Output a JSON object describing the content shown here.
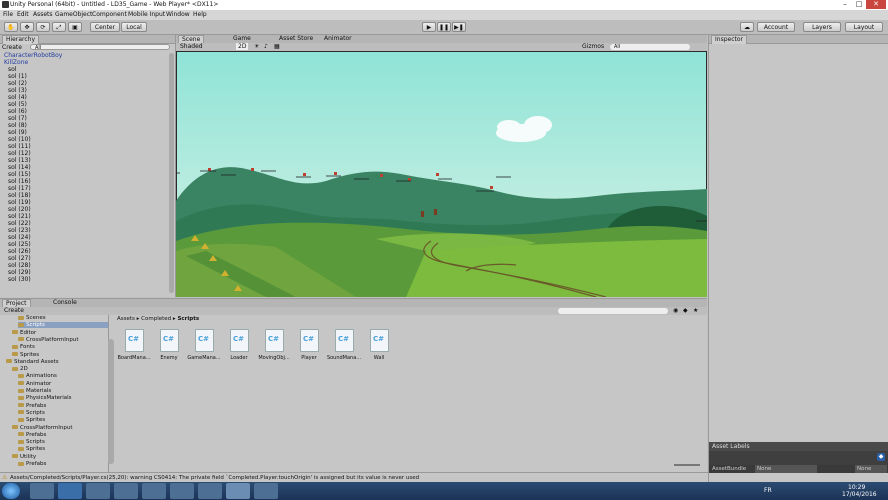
{
  "window": {
    "title": "Unity Personal (64bit) - Untitled - LD35_Game - Web Player* <DX11>"
  },
  "menu": [
    "File",
    "Edit",
    "Assets",
    "GameObject",
    "Component",
    "Mobile Input",
    "Window",
    "Help"
  ],
  "toolbar": {
    "pivot": "Center",
    "space": "Local",
    "account": "Account",
    "layers": "Layers",
    "layout": "Layout"
  },
  "hierarchy": {
    "tab": "Hierarchy",
    "create": "Create",
    "search": "All",
    "items": [
      "CharacterRobotBoy",
      "KillZone",
      "sol",
      "sol (1)",
      "sol (2)",
      "sol (3)",
      "sol (4)",
      "sol (5)",
      "sol (6)",
      "sol (7)",
      "sol (8)",
      "sol (9)",
      "sol (10)",
      "sol (11)",
      "sol (12)",
      "sol (13)",
      "sol (14)",
      "sol (15)",
      "sol (16)",
      "sol (17)",
      "sol (18)",
      "sol (19)",
      "sol (20)",
      "sol (21)",
      "sol (22)",
      "sol (23)",
      "sol (24)",
      "sol (25)",
      "sol (26)",
      "sol (27)",
      "sol (28)",
      "sol (29)",
      "sol (30)"
    ]
  },
  "scene": {
    "tabs": [
      "Scene",
      "Game",
      "Asset Store",
      "Animator"
    ],
    "shading": "Shaded",
    "mode": "2D",
    "gizmos": "Gizmos",
    "search": "All"
  },
  "inspector": {
    "tab": "Inspector",
    "asset_labels": "Asset Labels",
    "asset_bundle": "AssetBundle",
    "bundle_value": "None",
    "variant_value": "None"
  },
  "project": {
    "tabs": [
      "Project",
      "Console"
    ],
    "create": "Create",
    "breadcrumb": [
      "Assets",
      "Completed",
      "Scripts"
    ],
    "tree": [
      {
        "label": "Scenes",
        "indent": 3
      },
      {
        "label": "Scripts",
        "indent": 3
      },
      {
        "label": "Editor",
        "indent": 2
      },
      {
        "label": "CrossPlatformInput",
        "indent": 3
      },
      {
        "label": "Fonts",
        "indent": 2
      },
      {
        "label": "Sprites",
        "indent": 2
      },
      {
        "label": "Standard Assets",
        "indent": 1
      },
      {
        "label": "2D",
        "indent": 2
      },
      {
        "label": "Animations",
        "indent": 3
      },
      {
        "label": "Animator",
        "indent": 3
      },
      {
        "label": "Materials",
        "indent": 3
      },
      {
        "label": "PhysicsMaterials",
        "indent": 3
      },
      {
        "label": "Prefabs",
        "indent": 3
      },
      {
        "label": "Scripts",
        "indent": 3
      },
      {
        "label": "Sprites",
        "indent": 3
      },
      {
        "label": "CrossPlatformInput",
        "indent": 2
      },
      {
        "label": "Prefabs",
        "indent": 3
      },
      {
        "label": "Scripts",
        "indent": 3
      },
      {
        "label": "Sprites",
        "indent": 3
      },
      {
        "label": "Utility",
        "indent": 2
      },
      {
        "label": "Prefabs",
        "indent": 3
      }
    ],
    "scripts": [
      "BoardMana...",
      "Enemy",
      "GameMana...",
      "Loader",
      "MovingObj...",
      "Player",
      "SoundMana...",
      "Wall"
    ]
  },
  "status": {
    "message": "Assets/Completed/Scripts/Player.cs(25,20): warning CS0414: The private field `Completed.Player.touchOrigin' is assigned but its value is never used"
  },
  "taskbar": {
    "lang": "FR",
    "time": "10:29",
    "date": "17/04/2016"
  }
}
